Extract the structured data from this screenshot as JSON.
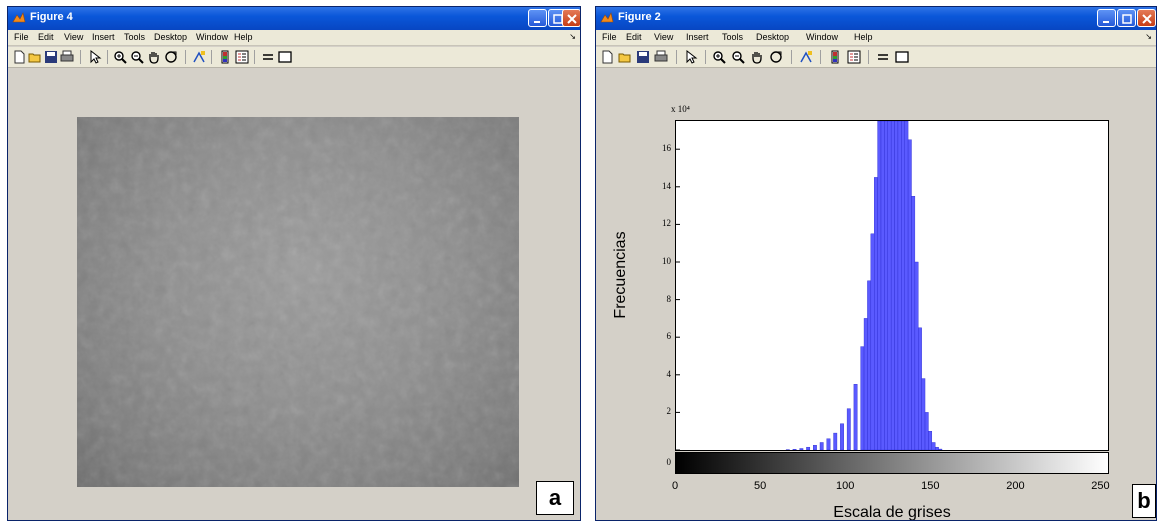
{
  "figure_a": {
    "title": "Figure 4",
    "menu": [
      "File",
      "Edit",
      "View",
      "Insert",
      "Tools",
      "Desktop",
      "Window",
      "Help"
    ],
    "label": "a"
  },
  "figure_b": {
    "title": "Figure 2",
    "menu": [
      "File",
      "Edit",
      "View",
      "Insert",
      "Tools",
      "Desktop",
      "Window",
      "Help"
    ],
    "label": "b"
  },
  "toolbar_icons": [
    "new-file-icon",
    "open-folder-icon",
    "save-icon",
    "print-icon",
    "pointer-icon",
    "zoom-in-icon",
    "zoom-out-icon",
    "pan-hand-icon",
    "rotate-icon",
    "data-cursor-icon",
    "colorbar-icon",
    "legend-icon",
    "hide-plot-tools-icon",
    "show-plot-tools-icon"
  ],
  "colors": {
    "titlebar": "#0a57d9",
    "histogram_bar": "#5a5aff",
    "window_bg": "#d4d0c8"
  },
  "chart_data": {
    "type": "bar",
    "title": "",
    "xlabel": "Escala de grises",
    "ylabel": "Frecuencias",
    "y_exponent": "x 10⁴",
    "xlim": [
      0,
      255
    ],
    "ylim": [
      0,
      17.5
    ],
    "xticks": [
      "0",
      "50",
      "100",
      "150",
      "200",
      "250"
    ],
    "yticks": [
      "0",
      "2",
      "4",
      "6",
      "8",
      "10",
      "12",
      "14",
      "16"
    ],
    "grid": false,
    "bins_x": [
      66,
      70,
      74,
      78,
      82,
      86,
      90,
      94,
      98,
      102,
      106,
      110,
      112,
      114,
      116,
      118,
      120,
      122,
      124,
      126,
      128,
      130,
      132,
      134,
      136,
      138,
      140,
      142,
      144,
      146,
      148,
      150,
      152,
      154,
      156
    ],
    "bins_y": [
      0.02,
      0.04,
      0.08,
      0.15,
      0.25,
      0.4,
      0.6,
      0.9,
      1.4,
      2.2,
      3.5,
      5.5,
      7.0,
      9.0,
      11.5,
      14.5,
      17.5,
      17.5,
      17.5,
      17.5,
      17.5,
      17.5,
      17.5,
      17.5,
      17.5,
      16.5,
      13.5,
      10.0,
      6.5,
      3.8,
      2.0,
      1.0,
      0.4,
      0.15,
      0.05
    ]
  }
}
